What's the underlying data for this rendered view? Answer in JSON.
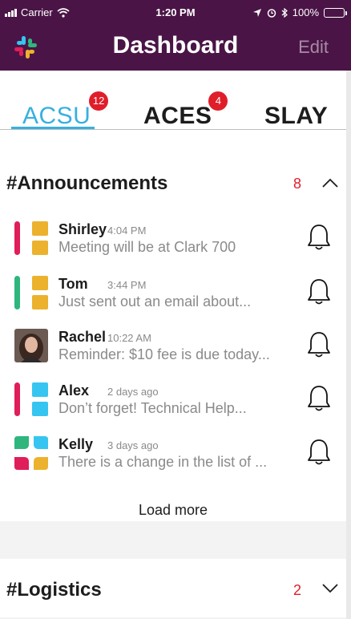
{
  "status_bar": {
    "carrier": "Carrier",
    "time": "1:20 PM",
    "battery": "100%"
  },
  "header": {
    "title": "Dashboard",
    "edit_label": "Edit",
    "logo_icon": "slack-logo-icon"
  },
  "tabs": [
    {
      "label": "ACSU",
      "badge": "12",
      "active": true
    },
    {
      "label": "ACES",
      "badge": "4",
      "active": false
    },
    {
      "label": "SLAY",
      "badge": "",
      "active": false
    }
  ],
  "channels": [
    {
      "name": "#Announcements",
      "count": "8",
      "expanded": true,
      "messages": [
        {
          "name": "Shirley",
          "time": "4:04 PM",
          "preview": "Meeting will be at Clark 700",
          "avatar": "red-yellow"
        },
        {
          "name": "Tom",
          "time": "3:44 PM",
          "preview": "Just sent out an email about...",
          "avatar": "green-yellow"
        },
        {
          "name": "Rachel",
          "time": "10:22 AM",
          "preview": "Reminder: $10 fee is due today...",
          "avatar": "photo"
        },
        {
          "name": "Alex",
          "time": "2 days ago",
          "preview": "Don’t forget! Technical Help...",
          "avatar": "red-blue"
        },
        {
          "name": "Kelly",
          "time": "3 days ago",
          "preview": "There is a change in the list of ...",
          "avatar": "four-color"
        }
      ],
      "load_more": "Load more"
    },
    {
      "name": "#Logistics",
      "count": "2",
      "expanded": false
    }
  ],
  "colors": {
    "header_bg": "#4a1546",
    "accent_blue": "#36b0e0",
    "badge_red": "#e01e2a",
    "slack_red": "#e01e5a",
    "slack_yellow": "#ecb22e",
    "slack_green": "#2eb67d",
    "slack_blue": "#36c5f0"
  }
}
